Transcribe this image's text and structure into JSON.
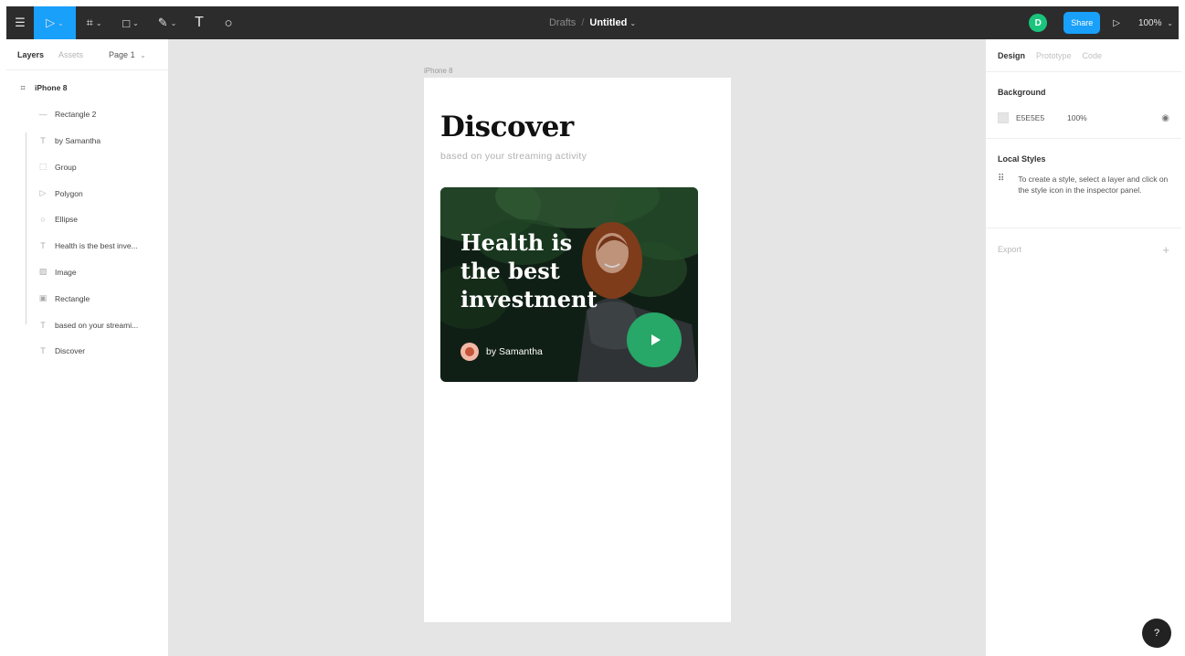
{
  "toolbar": {
    "menu_icon": "☰",
    "move_icon": "▷",
    "frame_icon": "⌗",
    "shape_icon": "□",
    "pen_icon": "✎",
    "text_icon": "T",
    "comment_icon": "○",
    "caret": "⌄",
    "folder": "Drafts",
    "separator": "/",
    "file_name": "Untitled",
    "file_caret": "⌄",
    "avatar_initial": "D",
    "share_label": "Share",
    "present_icon": "▷",
    "zoom": "100%",
    "zoom_caret": "⌄"
  },
  "left_panel": {
    "tab_layers": "Layers",
    "tab_assets": "Assets",
    "page": "Page 1",
    "page_caret": "⌄",
    "frame_icon": "⌗",
    "frame_name": "iPhone 8",
    "layers": [
      {
        "icon": "—",
        "name": "Rectangle 2"
      },
      {
        "icon": "T",
        "name": "by Samantha"
      },
      {
        "icon": "⬚",
        "name": "Group"
      },
      {
        "icon": "▷",
        "name": "Polygon"
      },
      {
        "icon": "○",
        "name": "Ellipse"
      },
      {
        "icon": "T",
        "name": "Health is the best inve..."
      },
      {
        "icon": "▨",
        "name": "Image"
      },
      {
        "icon": "▣",
        "name": "Rectangle"
      }
    ],
    "top_layers": [
      {
        "icon": "T",
        "name": "based on your streami..."
      },
      {
        "icon": "T",
        "name": "Discover"
      }
    ]
  },
  "canvas": {
    "frame_label": "iPhone 8",
    "title": "Discover",
    "subtitle": "based on your streaming activity",
    "card": {
      "title": "Health is the best investment",
      "author": "by Samantha"
    },
    "colors": {
      "canvas_bg": "#E5E5E5",
      "play_button": "#27A768",
      "toolbar_bg": "#2C2C2C",
      "accent": "#18A0FB"
    }
  },
  "right_panel": {
    "tab_design": "Design",
    "tab_prototype": "Prototype",
    "tab_code": "Code",
    "background_label": "Background",
    "background_hex": "E5E5E5",
    "background_opacity": "100%",
    "eye_icon": "◉",
    "local_styles_label": "Local Styles",
    "local_styles_icon": "⠿",
    "local_styles_note": "To create a style, select a layer and click on the style icon in the inspector panel.",
    "export_label": "Export",
    "export_add_icon": "+"
  },
  "help_icon": "?"
}
